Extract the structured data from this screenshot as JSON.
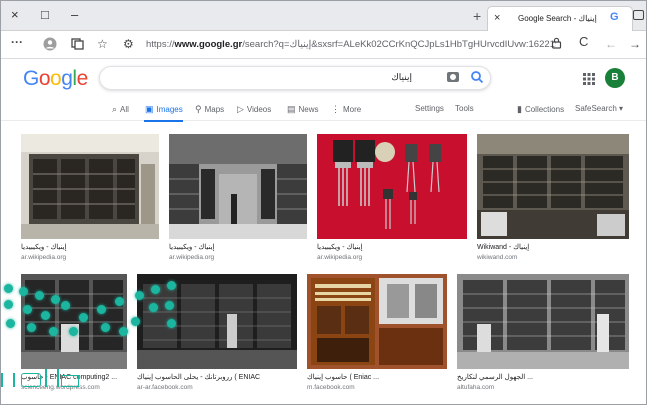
{
  "browser": {
    "tab_title": "Google Search - إينياك",
    "tab_close": "×",
    "tab_favicon": "G",
    "new_tab": "+",
    "win_close": "×",
    "win_restore": "□",
    "win_min": "–",
    "url_prefix": "https://",
    "url_domain": "www.google.gr",
    "url_rest": "/search?q=إينياك&sxsrf=ALeKk02CCrKnQCJpLs1HbTgHUrvcdIUvw:1622199...",
    "menu": "···",
    "back": "←",
    "reload": "C"
  },
  "google": {
    "logo": [
      "G",
      "o",
      "o",
      "g",
      "l",
      "e"
    ],
    "logo_colors": [
      "#4285f4",
      "#ea4335",
      "#fbbc05",
      "#4285f4",
      "#34a853",
      "#ea4335"
    ],
    "query": "إينياك",
    "avatar_letter": "B",
    "apps_icon": "⋮⋮⋮"
  },
  "tabs": {
    "all": "All",
    "images": "Images",
    "maps": "Maps",
    "videos": "Videos",
    "news": "News",
    "more": "More",
    "settings": "Settings",
    "tools": "Tools",
    "collections": "Collections",
    "safesearch": "SafeSearch ▾"
  },
  "results": [
    {
      "caption": "إينياك - ويكيبيديا",
      "source": "ar.wikipedia.org"
    },
    {
      "caption": "إينياك - ويكيبيديا",
      "source": "ar.wikipedia.org"
    },
    {
      "caption": "إينياك - ويكيبيديا",
      "source": "ar.wikipedia.org"
    },
    {
      "caption": "Wikiwand - إينياك",
      "source": "wikiwand.com"
    },
    {
      "caption": "حاسوب - ENIAC computing2 ...",
      "source": "scienceeng.wordpress.com"
    },
    {
      "caption": "رروبرتانك - يحلى الحاسوب إينياك ( ENIAC",
      "source": "ar-ar.facebook.com"
    },
    {
      "caption": "حاسوب إينياك ( Eniac ...",
      "source": "m.facebook.com"
    },
    {
      "caption": "الجهول الرسمي لنكاريخ ...",
      "source": "altufaha.com"
    }
  ],
  "colors": {
    "accent": "#1a73e8",
    "overlay": "#1bb5a0"
  }
}
